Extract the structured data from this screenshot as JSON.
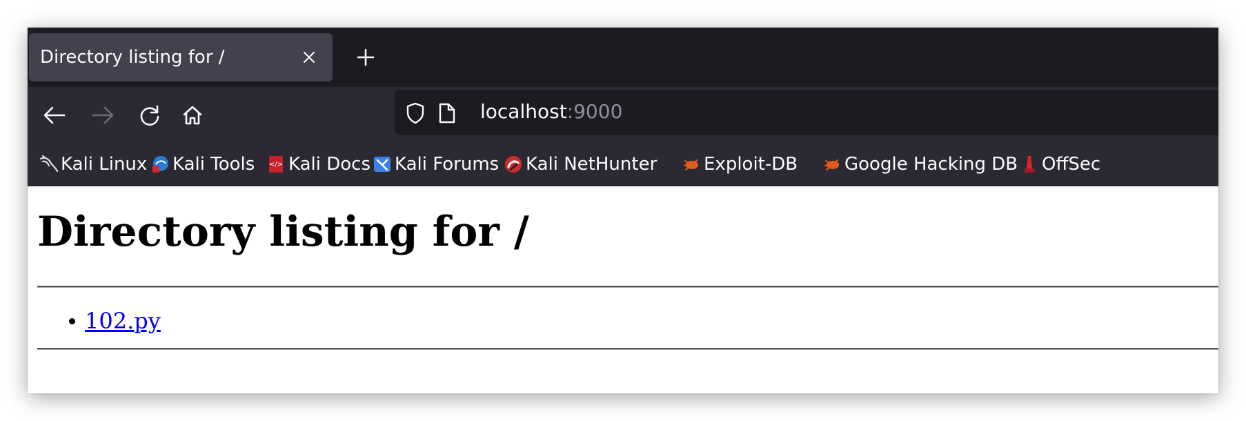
{
  "tabs": {
    "active": {
      "title": "Directory listing for /"
    }
  },
  "navigation": {
    "url": {
      "host": "localhost",
      "port": ":9000"
    }
  },
  "bookmarks": [
    {
      "label": "Kali Linux",
      "icon": "kali-dragon-icon"
    },
    {
      "label": "Kali Tools",
      "icon": "kali-tools-icon"
    },
    {
      "label": "Kali Docs",
      "icon": "kali-docs-icon"
    },
    {
      "label": "Kali Forums",
      "icon": "kali-forums-icon"
    },
    {
      "label": "Kali NetHunter",
      "icon": "kali-nethunter-icon"
    },
    {
      "label": "Exploit-DB",
      "icon": "exploit-db-icon"
    },
    {
      "label": "Google Hacking DB",
      "icon": "ghdb-icon"
    },
    {
      "label": "OffSec",
      "icon": "offsec-icon"
    }
  ],
  "page": {
    "title": "Directory listing for /",
    "files": [
      {
        "name": "102.py"
      }
    ]
  },
  "colors": {
    "tabbar_bg": "#1c1b22",
    "toolbar_bg": "#2b2a33",
    "active_tab_bg": "#42414d",
    "link": "#0000ee"
  }
}
